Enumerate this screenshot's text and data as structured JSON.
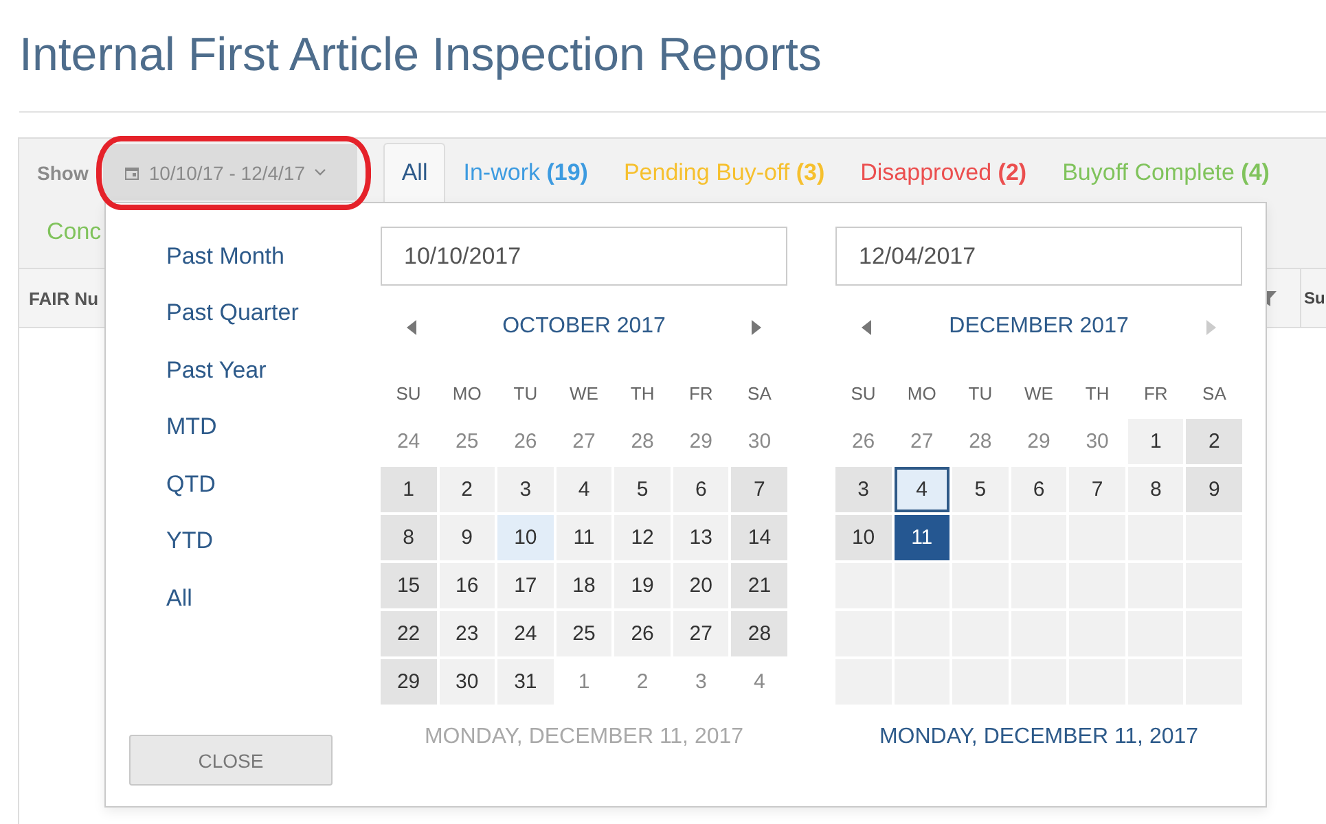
{
  "page": {
    "title": "Internal First Article Inspection Reports"
  },
  "toolbar": {
    "show_label": "Show",
    "date_range": "10/10/17 - 12/4/17",
    "tabs": [
      {
        "label": "All",
        "color": "#2d5a8a",
        "selected": true
      },
      {
        "label": "In-work **(19)**",
        "color": "#3d9be0",
        "selected": false
      },
      {
        "label": "Pending Buy-off **(3)**",
        "color": "#f6c02e",
        "selected": false
      },
      {
        "label": "Disapproved **(2)**",
        "color": "#eb4f4f",
        "selected": false
      },
      {
        "label": "Buyoff Complete **(4)**",
        "color": "#80c35c",
        "selected": false
      },
      {
        "label": "Conc",
        "color": "#80c35c",
        "selected": false
      }
    ]
  },
  "table": {
    "columns": [
      {
        "label": "FAIR Nu"
      },
      {
        "label": "Su"
      }
    ]
  },
  "date_picker": {
    "presets": [
      "Past Month",
      "Past Quarter",
      "Past Year",
      "MTD",
      "QTD",
      "YTD",
      "All"
    ],
    "close_button": "CLOSE",
    "calendars": [
      {
        "value": "10/10/2017",
        "month": "OCTOBER 2017",
        "prev_disabled": false,
        "next_disabled": false,
        "weekdays": [
          "SU",
          "MO",
          "TU",
          "WE",
          "TH",
          "FR",
          "SA"
        ],
        "weeks": [
          [
            {
              "day": "24",
              "kind": "outside",
              "selected": false
            },
            {
              "day": "25",
              "kind": "outside",
              "selected": false
            },
            {
              "day": "26",
              "kind": "outside",
              "selected": false
            },
            {
              "day": "27",
              "kind": "outside",
              "selected": false
            },
            {
              "day": "28",
              "kind": "outside",
              "selected": false
            },
            {
              "day": "29",
              "kind": "outside",
              "selected": false
            },
            {
              "day": "30",
              "kind": "outside",
              "selected": false
            }
          ],
          [
            {
              "day": "1",
              "kind": "day",
              "selected": false
            },
            {
              "day": "2",
              "kind": "day",
              "selected": false
            },
            {
              "day": "3",
              "kind": "day",
              "selected": false
            },
            {
              "day": "4",
              "kind": "day",
              "selected": false
            },
            {
              "day": "5",
              "kind": "day",
              "selected": false
            },
            {
              "day": "6",
              "kind": "day",
              "selected": false
            },
            {
              "day": "7",
              "kind": "day",
              "selected": false
            }
          ],
          [
            {
              "day": "8",
              "kind": "day",
              "selected": false
            },
            {
              "day": "9",
              "kind": "day",
              "selected": false
            },
            {
              "day": "10",
              "kind": "range-start",
              "selected": false
            },
            {
              "day": "11",
              "kind": "day",
              "selected": false
            },
            {
              "day": "12",
              "kind": "day",
              "selected": false
            },
            {
              "day": "13",
              "kind": "day",
              "selected": false
            },
            {
              "day": "14",
              "kind": "day",
              "selected": false
            }
          ],
          [
            {
              "day": "15",
              "kind": "day",
              "selected": false
            },
            {
              "day": "16",
              "kind": "day",
              "selected": false
            },
            {
              "day": "17",
              "kind": "day",
              "selected": false
            },
            {
              "day": "18",
              "kind": "day",
              "selected": false
            },
            {
              "day": "19",
              "kind": "day",
              "selected": false
            },
            {
              "day": "20",
              "kind": "day",
              "selected": false
            },
            {
              "day": "21",
              "kind": "day",
              "selected": false
            }
          ],
          [
            {
              "day": "22",
              "kind": "day",
              "selected": false
            },
            {
              "day": "23",
              "kind": "day",
              "selected": false
            },
            {
              "day": "24",
              "kind": "day",
              "selected": false
            },
            {
              "day": "25",
              "kind": "day",
              "selected": false
            },
            {
              "day": "26",
              "kind": "day",
              "selected": false
            },
            {
              "day": "27",
              "kind": "day",
              "selected": false
            },
            {
              "day": "28",
              "kind": "day",
              "selected": false
            }
          ],
          [
            {
              "day": "29",
              "kind": "day",
              "selected": false
            },
            {
              "day": "30",
              "kind": "day",
              "selected": false
            },
            {
              "day": "31",
              "kind": "day",
              "selected": false
            },
            {
              "day": "1",
              "kind": "outside",
              "selected": false
            },
            {
              "day": "2",
              "kind": "outside",
              "selected": false
            },
            {
              "day": "3",
              "kind": "outside",
              "selected": false
            },
            {
              "day": "4",
              "kind": "outside",
              "selected": false
            }
          ]
        ],
        "footer": "MONDAY, DECEMBER 11, 2017",
        "active": false
      },
      {
        "value": "12/04/2017",
        "month": "DECEMBER 2017",
        "prev_disabled": false,
        "next_disabled": true,
        "weekdays": [
          "SU",
          "MO",
          "TU",
          "WE",
          "TH",
          "FR",
          "SA"
        ],
        "weeks": [
          [
            {
              "day": "26",
              "kind": "outside",
              "selected": false
            },
            {
              "day": "27",
              "kind": "outside",
              "selected": false
            },
            {
              "day": "28",
              "kind": "outside",
              "selected": false
            },
            {
              "day": "29",
              "kind": "outside",
              "selected": false
            },
            {
              "day": "30",
              "kind": "outside",
              "selected": false
            },
            {
              "day": "1",
              "kind": "day",
              "selected": false
            },
            {
              "day": "2",
              "kind": "day",
              "selected": false
            }
          ],
          [
            {
              "day": "3",
              "kind": "day",
              "selected": false
            },
            {
              "day": "4",
              "kind": "range-end",
              "selected": false
            },
            {
              "day": "5",
              "kind": "day",
              "selected": false
            },
            {
              "day": "6",
              "kind": "day",
              "selected": false
            },
            {
              "day": "7",
              "kind": "day",
              "selected": false
            },
            {
              "day": "8",
              "kind": "day",
              "selected": false
            },
            {
              "day": "9",
              "kind": "day",
              "selected": false
            }
          ],
          [
            {
              "day": "10",
              "kind": "day",
              "selected": false
            },
            {
              "day": "11",
              "kind": "day",
              "selected": true
            },
            {
              "kind": "blank",
              "selected": false
            },
            {
              "kind": "blank",
              "selected": false
            },
            {
              "kind": "blank",
              "selected": false
            },
            {
              "kind": "blank",
              "selected": false
            },
            {
              "kind": "blank",
              "selected": false
            }
          ],
          [
            {
              "kind": "blank",
              "selected": false
            },
            {
              "kind": "blank",
              "selected": false
            },
            {
              "kind": "blank",
              "selected": false
            },
            {
              "kind": "blank",
              "selected": false
            },
            {
              "kind": "blank",
              "selected": false
            },
            {
              "kind": "blank",
              "selected": false
            },
            {
              "kind": "blank",
              "selected": false
            }
          ],
          [
            {
              "kind": "blank",
              "selected": false
            },
            {
              "kind": "blank",
              "selected": false
            },
            {
              "kind": "blank",
              "selected": false
            },
            {
              "kind": "blank",
              "selected": false
            },
            {
              "kind": "blank",
              "selected": false
            },
            {
              "kind": "blank",
              "selected": false
            },
            {
              "kind": "blank",
              "selected": false
            }
          ],
          [
            {
              "kind": "blank",
              "selected": false
            },
            {
              "kind": "blank",
              "selected": false
            },
            {
              "kind": "blank",
              "selected": false
            },
            {
              "kind": "blank",
              "selected": false
            },
            {
              "kind": "blank",
              "selected": false
            },
            {
              "kind": "blank",
              "selected": false
            },
            {
              "kind": "blank",
              "selected": false
            }
          ]
        ],
        "footer": "MONDAY, DECEMBER 11, 2017",
        "active": true
      }
    ]
  }
}
